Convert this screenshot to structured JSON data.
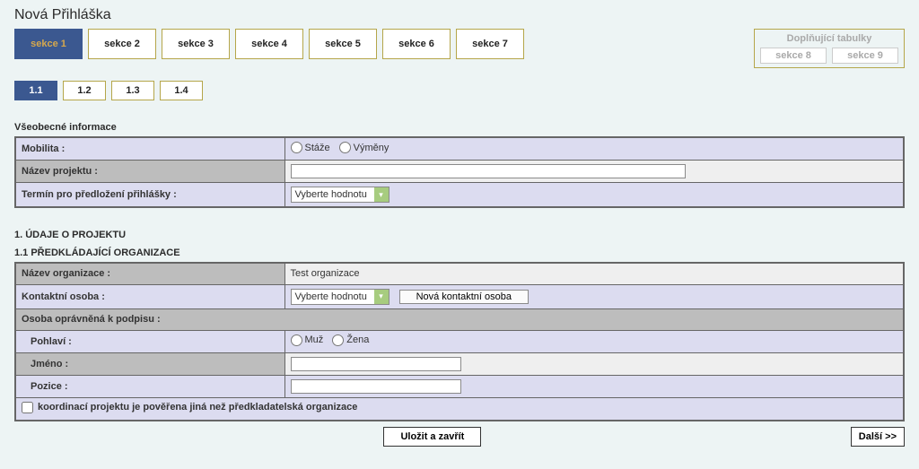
{
  "page_title": "Nová Přihláška",
  "tabs": [
    {
      "label": "sekce 1",
      "active": true
    },
    {
      "label": "sekce 2",
      "active": false
    },
    {
      "label": "sekce 3",
      "active": false
    },
    {
      "label": "sekce 4",
      "active": false
    },
    {
      "label": "sekce 5",
      "active": false
    },
    {
      "label": "sekce 6",
      "active": false
    },
    {
      "label": "sekce 7",
      "active": false
    }
  ],
  "tabs_disabled_group": {
    "header": "Doplňující tabulky",
    "items": [
      "sekce 8",
      "sekce 9"
    ]
  },
  "subtabs": [
    {
      "label": "1.1",
      "active": true
    },
    {
      "label": "1.2",
      "active": false
    },
    {
      "label": "1.3",
      "active": false
    },
    {
      "label": "1.4",
      "active": false
    }
  ],
  "sections": {
    "general_info": {
      "heading": "Všeobecné informace",
      "mobilita_label": "Mobilita :",
      "mobilita_opt_1": "Stáže",
      "mobilita_opt_2": "Výměny",
      "project_name_label": "Název projektu :",
      "project_name_value": "",
      "deadline_label": "Termín pro předložení přihlášky :",
      "deadline_select_text": "Vyberte hodnotu"
    },
    "project_data": {
      "heading": "1. ÚDAJE O PROJEKTU",
      "subheading": "1.1 PŘEDKLÁDAJÍCÍ ORGANIZACE",
      "org_name_label": "Název organizace :",
      "org_name_value": "Test organizace",
      "contact_person_label": "Kontaktní osoba :",
      "contact_select_text": "Vyberte hodnotu",
      "new_contact_button": "Nová kontaktní osoba",
      "signatory_header": "Osoba oprávněná k podpisu :",
      "gender_label": "Pohlaví :",
      "gender_opt_1": "Muž",
      "gender_opt_2": "Žena",
      "name_label": "Jméno :",
      "name_value": "",
      "position_label": "Pozice :",
      "position_value": "",
      "coord_checkbox_label": "koordinací projektu je pověřena jiná než předkladatelská organizace"
    }
  },
  "buttons": {
    "save_close": "Uložit a zavřít",
    "next": "Další >>"
  }
}
